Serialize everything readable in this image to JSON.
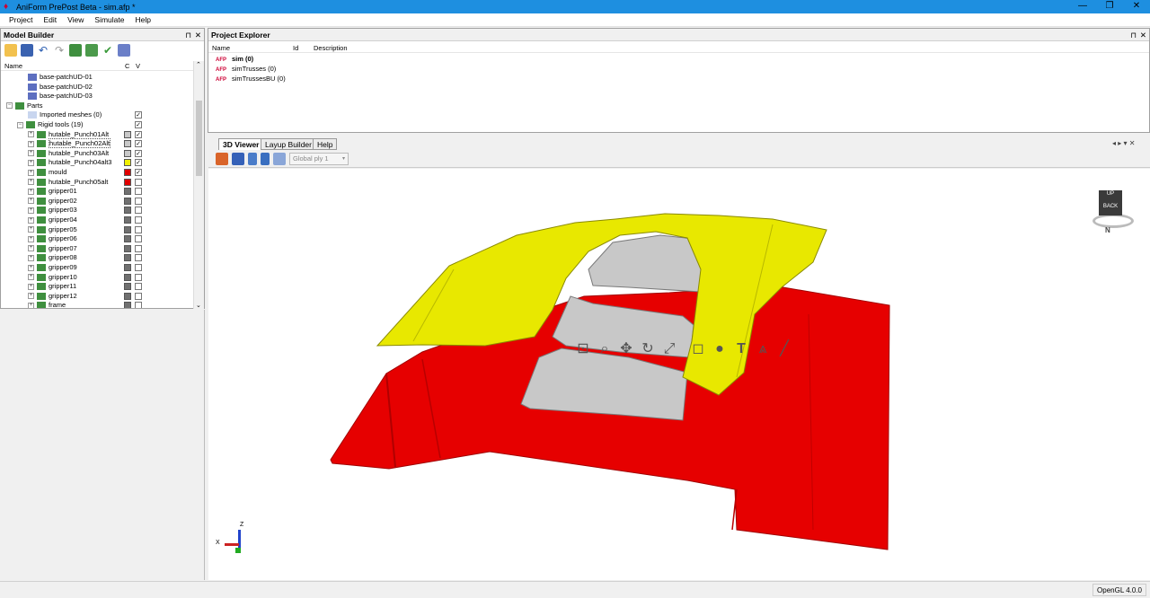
{
  "window": {
    "title": "AniForm PrePost Beta - sim.afp *",
    "min_label": "—",
    "restore_label": "❐",
    "close_label": "✕"
  },
  "menu": [
    "Project",
    "Edit",
    "View",
    "Simulate",
    "Help"
  ],
  "model_builder": {
    "title": "Model Builder",
    "columns": {
      "name": "Name",
      "c": "C",
      "v": "V"
    },
    "rows": [
      {
        "label": "base-patchUD-01",
        "indent": 30,
        "icon": "mesh-icon"
      },
      {
        "label": "base-patchUD-02",
        "indent": 30,
        "icon": "mesh-icon"
      },
      {
        "label": "base-patchUD-03",
        "indent": 30,
        "icon": "mesh-icon"
      },
      {
        "label": "Parts",
        "indent": 6,
        "icon": "parts-icon",
        "expand": "−"
      },
      {
        "label": "Imported meshes (0)",
        "indent": 30,
        "icon": "box-icon",
        "v": true
      },
      {
        "label": "Rigid tools (19)",
        "indent": 18,
        "icon": "tool-icon",
        "expand": "−",
        "v": true
      },
      {
        "label": "hutable_Punch01Alt",
        "indent": 30,
        "icon": "tool-icon",
        "expand": "+",
        "color": "#c8c8c8",
        "v": true
      },
      {
        "label": "hutable_Punch02Alt",
        "indent": 30,
        "icon": "tool-icon",
        "expand": "+",
        "color": "#c8c8c8",
        "v": true,
        "selected": true
      },
      {
        "label": "hutable_Punch03Alt",
        "indent": 30,
        "icon": "tool-icon",
        "expand": "+",
        "color": "#c8c8c8",
        "v": true
      },
      {
        "label": "hutable_Punch04alt3",
        "indent": 30,
        "icon": "tool-icon",
        "expand": "+",
        "color": "#f0f000",
        "v": true
      },
      {
        "label": "mould",
        "indent": 30,
        "icon": "tool-icon",
        "expand": "+",
        "color": "#e00000",
        "v": true
      },
      {
        "label": "hutable_Punch05alt",
        "indent": 30,
        "icon": "tool-icon",
        "expand": "+",
        "color": "#e00000",
        "v": false
      },
      {
        "label": "gripper01",
        "indent": 30,
        "icon": "tool-icon",
        "expand": "+",
        "color": "#707070",
        "v": false
      },
      {
        "label": "gripper02",
        "indent": 30,
        "icon": "tool-icon",
        "expand": "+",
        "color": "#707070",
        "v": false
      },
      {
        "label": "gripper03",
        "indent": 30,
        "icon": "tool-icon",
        "expand": "+",
        "color": "#707070",
        "v": false
      },
      {
        "label": "gripper04",
        "indent": 30,
        "icon": "tool-icon",
        "expand": "+",
        "color": "#707070",
        "v": false
      },
      {
        "label": "gripper05",
        "indent": 30,
        "icon": "tool-icon",
        "expand": "+",
        "color": "#707070",
        "v": false
      },
      {
        "label": "gripper06",
        "indent": 30,
        "icon": "tool-icon",
        "expand": "+",
        "color": "#707070",
        "v": false
      },
      {
        "label": "gripper07",
        "indent": 30,
        "icon": "tool-icon",
        "expand": "+",
        "color": "#707070",
        "v": false
      },
      {
        "label": "gripper08",
        "indent": 30,
        "icon": "tool-icon",
        "expand": "+",
        "color": "#707070",
        "v": false
      },
      {
        "label": "gripper09",
        "indent": 30,
        "icon": "tool-icon",
        "expand": "+",
        "color": "#707070",
        "v": false
      },
      {
        "label": "gripper10",
        "indent": 30,
        "icon": "tool-icon",
        "expand": "+",
        "color": "#707070",
        "v": false
      },
      {
        "label": "gripper11",
        "indent": 30,
        "icon": "tool-icon",
        "expand": "+",
        "color": "#707070",
        "v": false
      },
      {
        "label": "gripper12",
        "indent": 30,
        "icon": "tool-icon",
        "expand": "+",
        "color": "#707070",
        "v": false
      },
      {
        "label": "frame",
        "indent": 30,
        "icon": "tool-icon",
        "expand": "+",
        "color": "#707070",
        "v": false
      }
    ]
  },
  "project_explorer": {
    "title": "Project Explorer",
    "columns": {
      "name": "Name",
      "id": "Id",
      "description": "Description"
    },
    "items": [
      {
        "label": "sim (0)",
        "bold": true
      },
      {
        "label": "simTrusses (0)",
        "bold": false
      },
      {
        "label": "simTrussesBU (0)",
        "bold": false
      }
    ]
  },
  "tabs": [
    "3D Viewer",
    "Layup Builder",
    "Help"
  ],
  "viewer": {
    "ply_select": "Global ply 1",
    "cube_label": "BACK",
    "cube_top_label": "UP",
    "compass": "N",
    "axes": {
      "z": "Z",
      "x": "X"
    }
  },
  "status": {
    "opengl": "OpenGL 4.0.0"
  },
  "colors": {
    "accent": "#1e8fe0",
    "mould": "#e00000",
    "punch": "#c8c8c8",
    "yellow": "#e8e800"
  }
}
